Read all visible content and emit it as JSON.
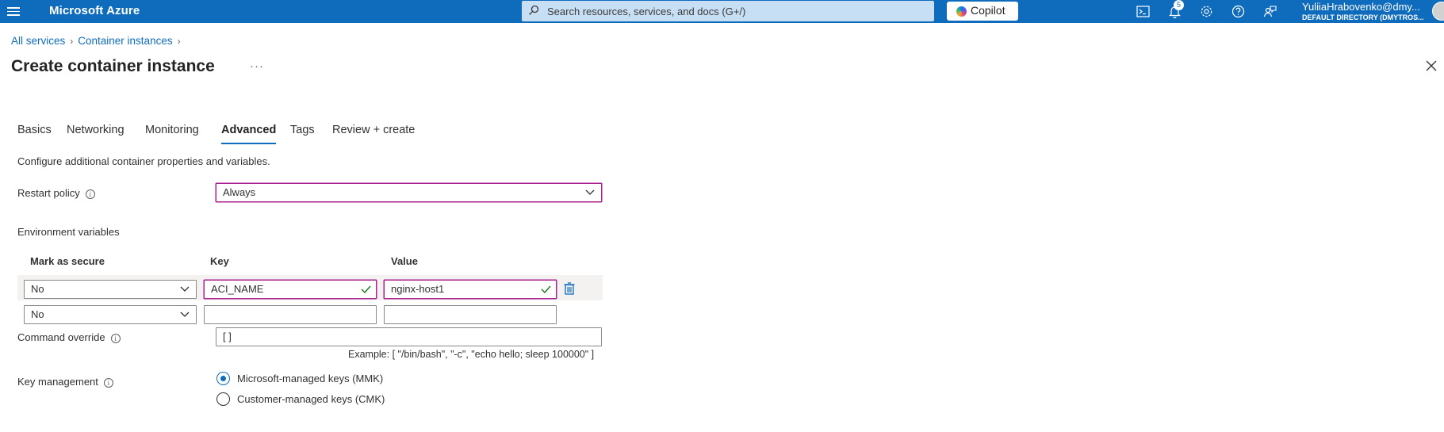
{
  "topbar": {
    "brand": "Microsoft Azure",
    "search_placeholder": "Search resources, services, and docs (G+/)",
    "copilot_label": "Copilot",
    "notification_count": "5",
    "user_name": "YuliiaHrabovenko@dmy...",
    "user_directory": "DEFAULT DIRECTORY (DMYTROS...",
    "icons": [
      "cloud-shell-icon",
      "bell-icon",
      "gear-icon",
      "help-icon",
      "feedback-icon"
    ]
  },
  "breadcrumb": {
    "items": [
      "All services",
      "Container instances"
    ]
  },
  "page": {
    "title": "Create container instance",
    "more": "···"
  },
  "tabs": [
    {
      "label": "Basics",
      "active": false
    },
    {
      "label": "Networking",
      "active": false
    },
    {
      "label": "Monitoring",
      "active": false
    },
    {
      "label": "Advanced",
      "active": true
    },
    {
      "label": "Tags",
      "active": false
    },
    {
      "label": "Review + create",
      "active": false
    }
  ],
  "form": {
    "description": "Configure additional container properties and variables.",
    "restart_policy": {
      "label": "Restart policy",
      "value": "Always"
    },
    "env_vars": {
      "label": "Environment variables",
      "columns": [
        "Mark as secure",
        "Key",
        "Value"
      ],
      "rows": [
        {
          "secure": "No",
          "key": "ACI_NAME",
          "value": "nginx-host1"
        },
        {
          "secure": "No",
          "key": "",
          "value": ""
        }
      ]
    },
    "command_override": {
      "label": "Command override",
      "value": "[ ]",
      "example": "Example: [ \"/bin/bash\", \"-c\", \"echo hello; sleep 100000\" ]"
    },
    "key_management": {
      "label": "Key management",
      "options": [
        {
          "label": "Microsoft-managed keys (MMK)",
          "selected": true
        },
        {
          "label": "Customer-managed keys (CMK)",
          "selected": false
        }
      ]
    }
  },
  "colors": {
    "topbar": "#0f6cbd",
    "focus_border": "#a9228f",
    "link": "#0f6cbd",
    "valid_check": "#107c10"
  }
}
